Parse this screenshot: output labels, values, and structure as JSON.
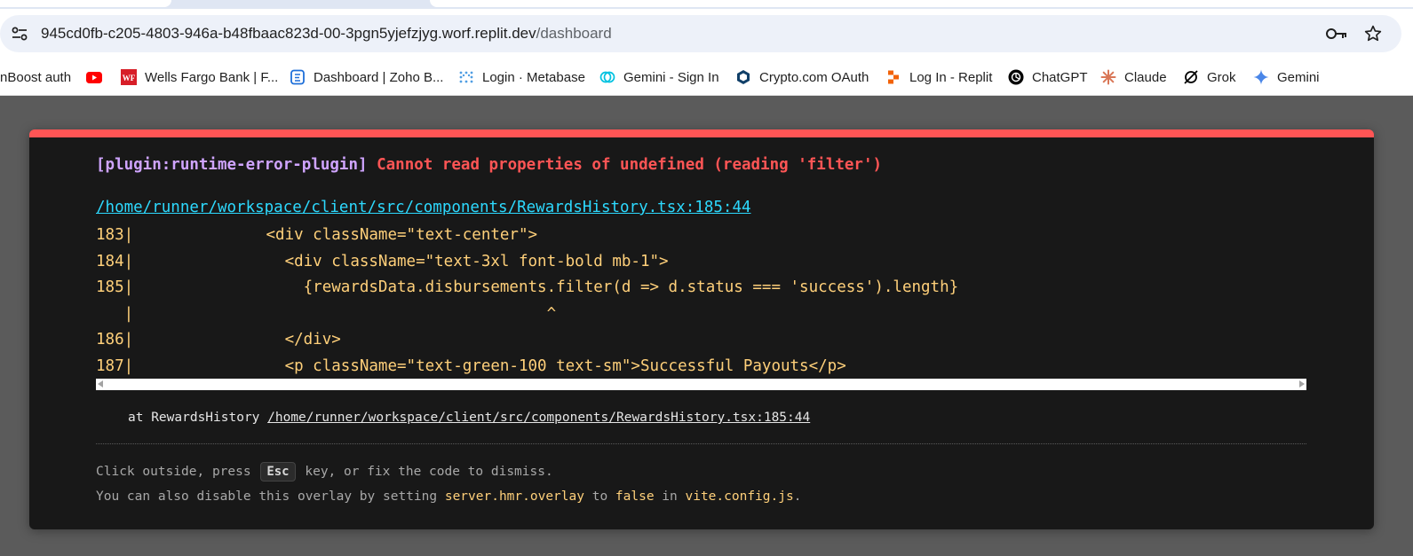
{
  "browser": {
    "url_host": "945cd0fb-c205-4803-946a-b48fbaac823d-00-3pgn5yjefzjyg.worf.replit.dev",
    "url_path": "/dashboard",
    "bookmarks": [
      {
        "label": "nBoost auth",
        "icon": "none"
      },
      {
        "label": "",
        "icon": "youtube-icon",
        "color": "#ff0000"
      },
      {
        "label": "Wells Fargo Bank | F...",
        "icon": "wells-fargo-icon",
        "icon_text": "WF",
        "color": "#d71e28"
      },
      {
        "label": "Dashboard | Zoho B...",
        "icon": "zoho-books-icon",
        "color": "#1e6fd9"
      },
      {
        "label": "Login · Metabase",
        "icon": "metabase-icon",
        "color": "#509ee3"
      },
      {
        "label": "Gemini - Sign In",
        "icon": "gemini-exchange-icon",
        "color": "#00dcfa"
      },
      {
        "label": "Crypto.com OAuth",
        "icon": "crypto-com-icon",
        "color": "#103f68"
      },
      {
        "label": "Log In - Replit",
        "icon": "replit-icon",
        "color": "#f26207"
      },
      {
        "label": "ChatGPT",
        "icon": "chatgpt-icon",
        "color": "#000000"
      },
      {
        "label": "Claude",
        "icon": "claude-icon",
        "color": "#d97757"
      },
      {
        "label": "Grok",
        "icon": "grok-icon",
        "color": "#000000"
      },
      {
        "label": "Gemini",
        "icon": "gemini-icon",
        "color": "#4a86e8"
      }
    ]
  },
  "overlay": {
    "plugin": "[plugin:runtime-error-plugin]",
    "message": "Cannot read properties of undefined (reading 'filter')",
    "file": "/home/runner/workspace/client/src/components/RewardsHistory.tsx:185:44",
    "frame": [
      {
        "ln": "183|",
        "code": "              <div className=\"text-center\">"
      },
      {
        "ln": "184|",
        "code": "                <div className=\"text-3xl font-bold mb-1\">"
      },
      {
        "ln": "185|",
        "code": "                  {rewardsData.disbursements.filter(d => d.status === 'success').length}"
      },
      {
        "ln": "   |",
        "code": "                                            ^"
      },
      {
        "ln": "186|",
        "code": "                </div>"
      },
      {
        "ln": "187|",
        "code": "                <p className=\"text-green-100 text-sm\">Successful Payouts</p>"
      }
    ],
    "stack_prefix": "at RewardsHistory ",
    "stack_link": "/home/runner/workspace/client/src/components/RewardsHistory.tsx:185:44",
    "tip1_before": "Click outside, press ",
    "tip1_key": "Esc",
    "tip1_after": " key, or fix the code to dismiss.",
    "tip2_a": "You can also disable this overlay by setting ",
    "tip2_b": "server.hmr.overlay",
    "tip2_c": " to ",
    "tip2_d": "false",
    "tip2_e": " in ",
    "tip2_f": "vite.config.js",
    "tip2_g": ".",
    "colors": {
      "accent_border": "#ff5555",
      "plugin": "#cfa4ff",
      "error": "#ff5555",
      "link": "#2dd9fe",
      "code": "#ffd07a"
    }
  }
}
